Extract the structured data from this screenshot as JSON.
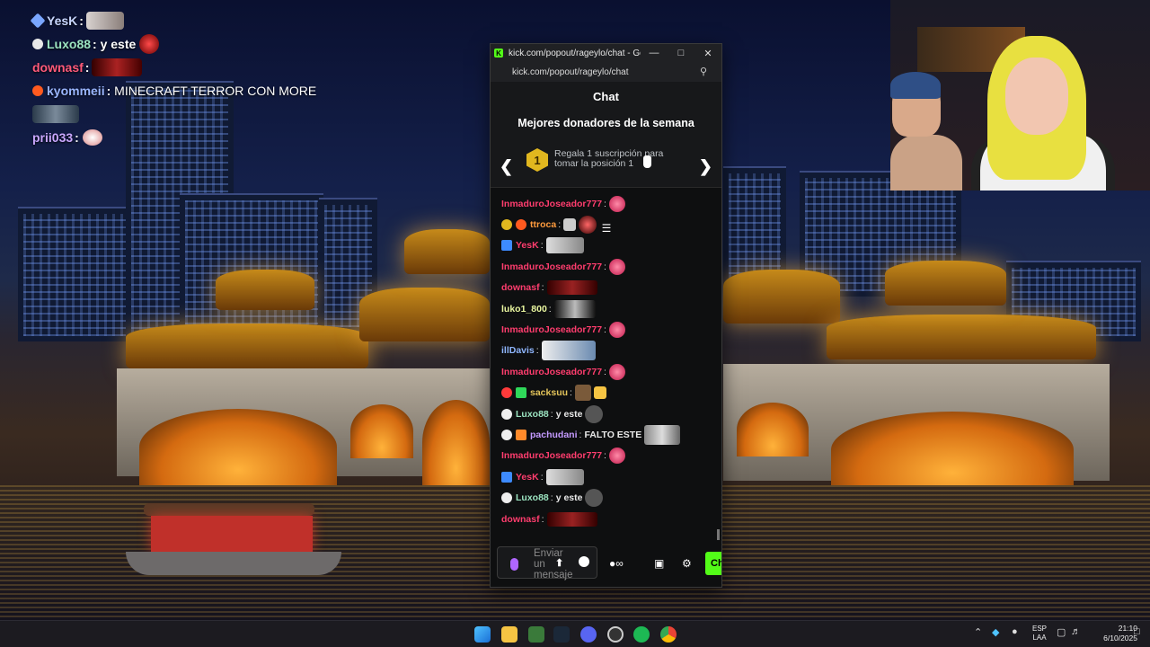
{
  "overlay_chat": [
    {
      "user": "YesK",
      "color": "#c8d6ff",
      "badge": "sword",
      "text": ""
    },
    {
      "user": "Luxo88",
      "color": "#9be3c0",
      "badge": "skull",
      "text": "y este"
    },
    {
      "user": "downasf",
      "color": "#ff5a7a",
      "badge": "",
      "text": ""
    },
    {
      "user": "kyommeii",
      "color": "#9ab6ff",
      "badge": "fire",
      "text": "MINECRAFT TERROR CON MORE"
    },
    {
      "user": "prii033",
      "color": "#c9a7ff",
      "badge": "",
      "text": ""
    }
  ],
  "browser": {
    "title": "kick.com/popout/rageylo/chat - Google...",
    "url": "kick.com/popout/rageylo/chat",
    "favicon": "K"
  },
  "chat": {
    "header": "Chat",
    "donors_title": "Mejores donadores de la semana",
    "donor_rank": "1",
    "donor_message": "Regala 1 suscripción para tomar la posición 1",
    "input_placeholder": "Enviar un mensaje",
    "send_label": "Ch",
    "messages": [
      {
        "user": "InmaduroJoseador777",
        "color": "#ff3d6e",
        "text": ""
      },
      {
        "user": "ttroca",
        "color": "#ff9b3d",
        "text": ""
      },
      {
        "user": "YesK",
        "color": "#ff3d6e",
        "text": ""
      },
      {
        "user": "InmaduroJoseador777",
        "color": "#ff3d6e",
        "text": ""
      },
      {
        "user": "downasf",
        "color": "#ff3d6e",
        "text": ""
      },
      {
        "user": "luko1_800",
        "color": "#eaf7a0",
        "text": ""
      },
      {
        "user": "InmaduroJoseador777",
        "color": "#ff3d6e",
        "text": ""
      },
      {
        "user": "illDavis",
        "color": "#8fb6ff",
        "text": ""
      },
      {
        "user": "InmaduroJoseador777",
        "color": "#ff3d6e",
        "text": ""
      },
      {
        "user": "sacksuu",
        "color": "#e3c45a",
        "text": ""
      },
      {
        "user": "Luxo88",
        "color": "#9be3c0",
        "text": "y este"
      },
      {
        "user": "pachudani",
        "color": "#c59bff",
        "text": "FALTO ESTE"
      },
      {
        "user": "InmaduroJoseador777",
        "color": "#ff3d6e",
        "text": ""
      },
      {
        "user": "YesK",
        "color": "#ff3d6e",
        "text": ""
      },
      {
        "user": "Luxo88",
        "color": "#9be3c0",
        "text": "y este"
      },
      {
        "user": "downasf",
        "color": "#ff3d6e",
        "text": ""
      }
    ]
  },
  "taskbar": {
    "language": "ESP",
    "layout": "LAA",
    "time": "21:10",
    "date": "6/10/2025"
  },
  "colors": {
    "kick_green": "#53fc18",
    "popup_bg": "#0e0f10",
    "taskbar_bg": "#1c1b20"
  }
}
